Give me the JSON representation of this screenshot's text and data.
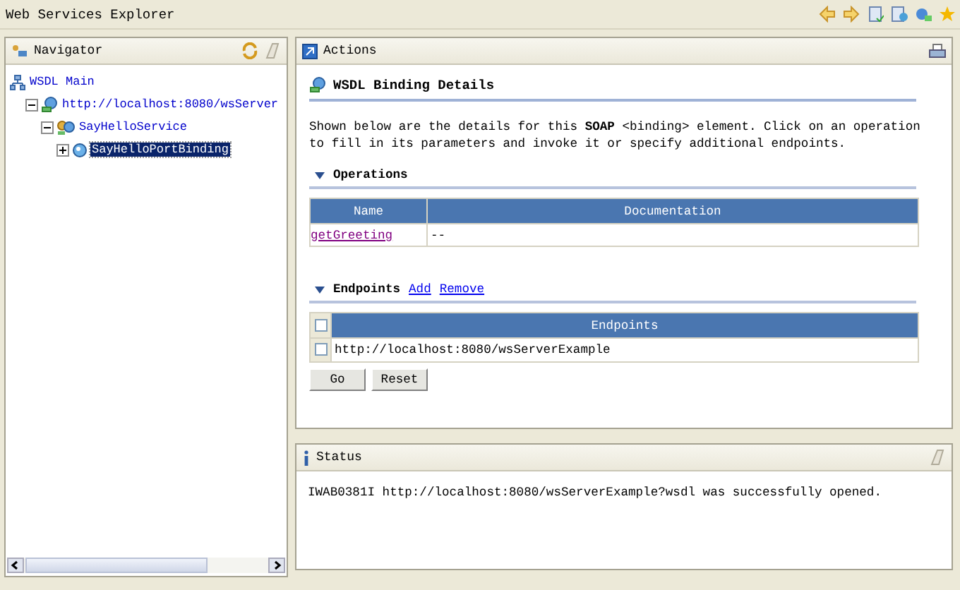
{
  "window": {
    "title": "Web Services Explorer"
  },
  "navigator": {
    "title": "Navigator",
    "tree": [
      {
        "label": "WSDL Main",
        "kind": "root",
        "selected": false,
        "children": [
          {
            "label": "http://localhost:8080/wsServer",
            "kind": "wsdl",
            "expanded": true,
            "selected": false,
            "children": [
              {
                "label": "SayHelloService",
                "kind": "service",
                "expanded": true,
                "selected": false,
                "children": [
                  {
                    "label": "SayHelloPortBinding",
                    "kind": "binding",
                    "expanded": false,
                    "selected": true
                  }
                ]
              }
            ]
          }
        ]
      }
    ]
  },
  "actions": {
    "title": "Actions",
    "heading": "WSDL Binding Details",
    "description": "Shown below are the details for this **SOAP** <binding> element. Click on an operation to fill in its parameters and invoke it or specify additional endpoints.",
    "operations": {
      "title": "Operations",
      "expanded": true,
      "columns": [
        "Name",
        "Documentation"
      ],
      "rows": [
        {
          "name": "getGreeting",
          "documentation": "--"
        }
      ]
    },
    "endpoints": {
      "title": "Endpoints",
      "expanded": true,
      "links": [
        "Add",
        "Remove"
      ],
      "header_checked": false,
      "column": "Endpoints",
      "rows": [
        {
          "checked": false,
          "url": "http://localhost:8080/wsServerExample"
        }
      ]
    },
    "buttons": [
      "Go",
      "Reset"
    ]
  },
  "status": {
    "title": "Status",
    "message": "IWAB0381I http://localhost:8080/wsServerExample?wsdl was successfully opened."
  }
}
